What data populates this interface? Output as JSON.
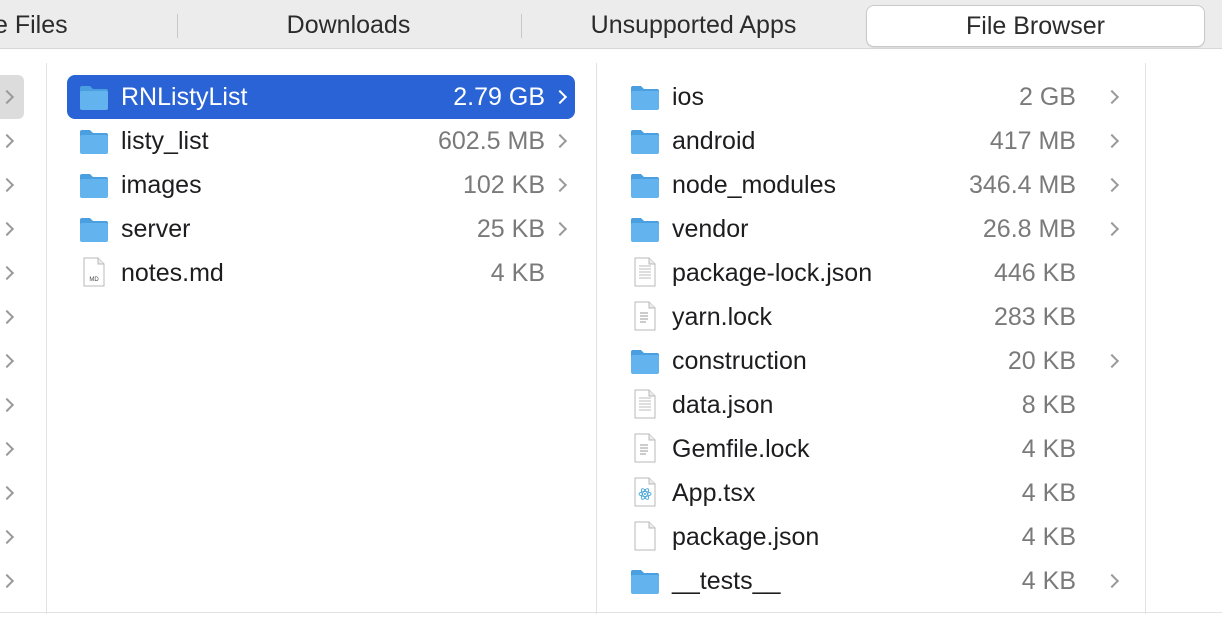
{
  "tabs": [
    {
      "label": "e Files"
    },
    {
      "label": "Downloads"
    },
    {
      "label": "Unsupported Apps"
    },
    {
      "label": "File Browser"
    }
  ],
  "active_tab": "File Browser",
  "column2": [
    {
      "name": "RNListyList",
      "size": "2.79 GB",
      "type": "folder",
      "selected": true
    },
    {
      "name": "listy_list",
      "size": "602.5 MB",
      "type": "folder"
    },
    {
      "name": "images",
      "size": "102 KB",
      "type": "folder"
    },
    {
      "name": "server",
      "size": "25 KB",
      "type": "folder"
    },
    {
      "name": "notes.md",
      "size": "4 KB",
      "type": "md-file"
    }
  ],
  "column3": [
    {
      "name": "ios",
      "size": "2 GB",
      "type": "folder"
    },
    {
      "name": "android",
      "size": "417 MB",
      "type": "folder"
    },
    {
      "name": "node_modules",
      "size": "346.4 MB",
      "type": "folder"
    },
    {
      "name": "vendor",
      "size": "26.8 MB",
      "type": "folder"
    },
    {
      "name": "package-lock.json",
      "size": "446 KB",
      "type": "json-file"
    },
    {
      "name": "yarn.lock",
      "size": "283 KB",
      "type": "text-file"
    },
    {
      "name": "construction",
      "size": "20 KB",
      "type": "folder"
    },
    {
      "name": "data.json",
      "size": "8 KB",
      "type": "json-file"
    },
    {
      "name": "Gemfile.lock",
      "size": "4 KB",
      "type": "text-file"
    },
    {
      "name": "App.tsx",
      "size": "4 KB",
      "type": "tsx-file"
    },
    {
      "name": "package.json",
      "size": "4 KB",
      "type": "plain-file"
    },
    {
      "name": "__tests__",
      "size": "4 KB",
      "type": "folder"
    }
  ],
  "colors": {
    "selection": "#2a63d6",
    "folder": "#62b3ee",
    "size_text": "#7a7a7a"
  }
}
